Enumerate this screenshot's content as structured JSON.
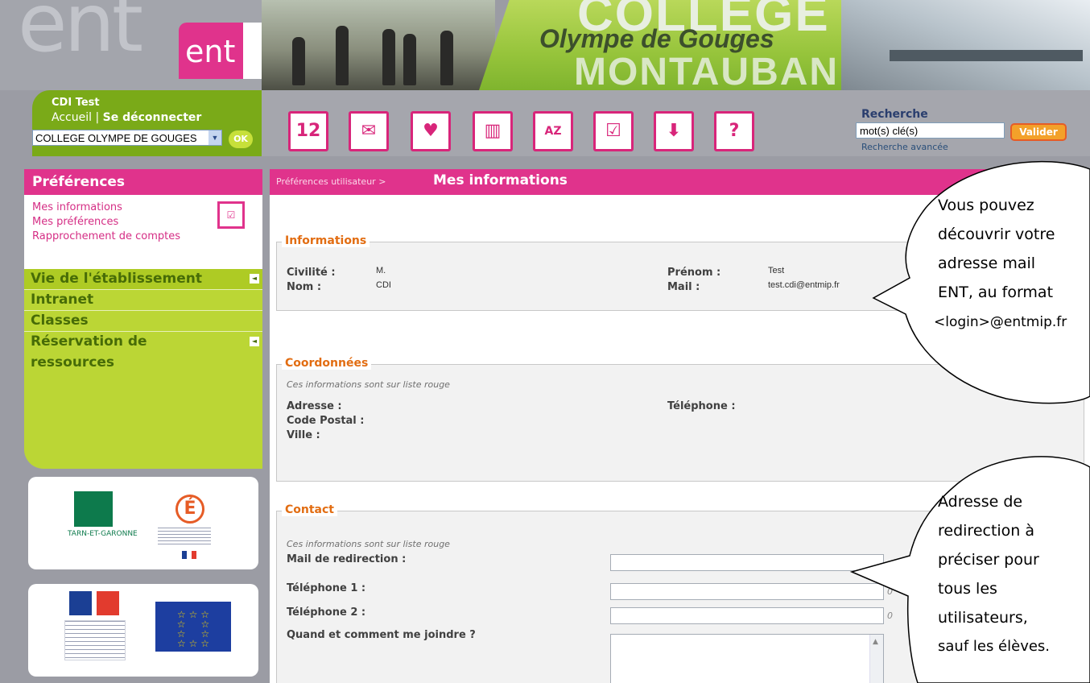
{
  "header": {
    "ent_logo": "ent",
    "college_title": "COLLEGE",
    "college_name": "Olympe de Gouges",
    "city": "MONTAUBAN"
  },
  "user_panel": {
    "user_name": "CDI Test",
    "home_link": "Accueil",
    "separator": "|",
    "logout_link": "Se déconnecter",
    "site_select_value": "COLLEGE OLYMPE DE GOUGES",
    "ok_label": "OK"
  },
  "toolbar": {
    "icons": [
      {
        "name": "agenda-icon",
        "glyph": "12"
      },
      {
        "name": "mail-icon",
        "glyph": "✉"
      },
      {
        "name": "favorites-icon",
        "glyph": "♥"
      },
      {
        "name": "documents-icon",
        "glyph": "▥"
      },
      {
        "name": "directory-icon",
        "glyph": "AZ"
      },
      {
        "name": "preferences-icon",
        "glyph": "☑"
      },
      {
        "name": "download-icon",
        "glyph": "⬇"
      },
      {
        "name": "help-icon",
        "glyph": "?"
      }
    ],
    "search_label": "Recherche",
    "search_value": "mot(s) clé(s)",
    "search_button": "Valider",
    "advanced_search": "Recherche avancée"
  },
  "sidebar": {
    "section_title": "Préférences",
    "pref_links": [
      "Mes informations",
      "Mes préférences",
      "Rapprochement de comptes"
    ],
    "menu": [
      {
        "label": "Vie de l'établissement",
        "has_arrow": true
      },
      {
        "label": "Intranet",
        "has_arrow": false
      },
      {
        "label": "Classes",
        "has_arrow": false
      },
      {
        "label": "Réservation de",
        "has_arrow": true
      },
      {
        "label": "ressources",
        "has_arrow": false
      }
    ],
    "partner_tarn": "TARN-ET-GARONNE",
    "partner_academie": "É"
  },
  "breadcrumb": {
    "parent": "Préférences utilisateur >",
    "current": "Mes informations"
  },
  "informations": {
    "legend": "Informations",
    "civilite_label": "Civilité :",
    "civilite_value": "M.",
    "nom_label": "Nom :",
    "nom_value": "CDI",
    "prenom_label": "Prénom :",
    "prenom_value": "Test",
    "mail_label": "Mail :",
    "mail_value": "test.cdi@entmip.fr"
  },
  "coordonnees": {
    "legend": "Coordonnées",
    "note": "Ces informations sont sur liste rouge",
    "adresse_label": "Adresse :",
    "telephone_label": "Téléphone :",
    "code_postal_label": "Code Postal :",
    "ville_label": "Ville :"
  },
  "contact": {
    "legend": "Contact",
    "note": "Ces informations sont sur liste rouge",
    "mail_redirection_label": "Mail de redirection :",
    "mail_redirection_value": "",
    "telephone1_label": "Téléphone 1 :",
    "telephone1_value": "",
    "telephone2_label": "Téléphone 2 :",
    "telephone2_value": "",
    "joindre_label": "Quand et comment me joindre ?",
    "joindre_value": "",
    "side_hint_1": "0",
    "side_hint_2": "0"
  },
  "callouts": {
    "bubble1": [
      "Vous pouvez",
      "découvrir votre",
      "adresse mail",
      "ENT, au format",
      "<login>@entmip.fr"
    ],
    "bubble2": [
      "Adresse de",
      "redirection à",
      "préciser pour",
      "tous les",
      "utilisateurs,",
      "sauf les élèves."
    ]
  }
}
